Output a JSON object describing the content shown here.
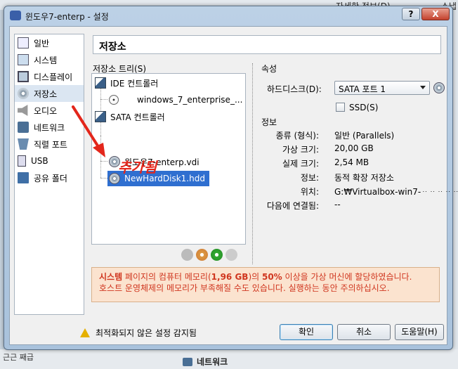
{
  "background": {
    "top_left_items": [
      "",
      ""
    ],
    "top_right_items": [
      "자세한 정보(D)",
      "스냅"
    ],
    "bottom_left_text": "근근 째급",
    "bottom_network": "네트워크"
  },
  "window": {
    "title": "윈도우7-enterp - 설정",
    "help_label": "?",
    "close_label": "X"
  },
  "sidebar": {
    "items": [
      {
        "label": "일반",
        "icon": "general-icon"
      },
      {
        "label": "시스템",
        "icon": "system-icon"
      },
      {
        "label": "디스플레이",
        "icon": "display-icon"
      },
      {
        "label": "저장소",
        "icon": "storage-icon"
      },
      {
        "label": "오디오",
        "icon": "audio-icon"
      },
      {
        "label": "네트워크",
        "icon": "network-icon"
      },
      {
        "label": "직렬 포트",
        "icon": "serial-port-icon"
      },
      {
        "label": "USB",
        "icon": "usb-icon"
      },
      {
        "label": "공유 폴더",
        "icon": "shared-folder-icon"
      }
    ],
    "selected_index": 3
  },
  "page_title": "저장소",
  "tree": {
    "label": "저장소 트리(S)",
    "ide_controller": "IDE 컨트롤러",
    "ide_disc": "windows_7_enterprise_...",
    "sata_controller": "SATA 컨트롤러",
    "sata_disk1": "윈도우7-enterp.vdi",
    "sata_disk2": "NewHardDisk1.hdd"
  },
  "attributes": {
    "header": "속성",
    "harddisk_label": "하드디스크(D):",
    "harddisk_value": "SATA 포트 1",
    "ssd_label": "SSD(S)"
  },
  "info": {
    "header": "정보",
    "rows": [
      {
        "label": "종류 (형식):",
        "value": "일반 (Parallels)"
      },
      {
        "label": "가상 크기:",
        "value": "20,00 GB"
      },
      {
        "label": "실제 크기:",
        "value": "2,54 MB"
      },
      {
        "label": "정보:",
        "value": "동적 확장 저장소"
      },
      {
        "label": "위치:",
        "value": "G:₩Virtualbox-win7-ᆢᆢᆢᆢᆢ"
      },
      {
        "label": "다음에 연결됨:",
        "value": "--"
      }
    ]
  },
  "warning": {
    "part1": "시스템",
    "part2": " 페이지의 컴퓨터 메모리(",
    "part3": "1,96 GB",
    "part4": ")의 ",
    "part5": "50%",
    "part6": " 이상을 가상 머신에 할당하였습니다.",
    "line2": "호스트 운영체제의 메모리가 부족해질 수도 있습니다. 실행하는 동안 주의하십시오."
  },
  "footer": {
    "invalid_settings": "최적화되지 않은 설정 감지됨",
    "ok": "확인",
    "cancel": "취소",
    "help": "도움말(H)"
  },
  "annotation": {
    "text": "추가됨",
    "color": "#e3261b"
  }
}
